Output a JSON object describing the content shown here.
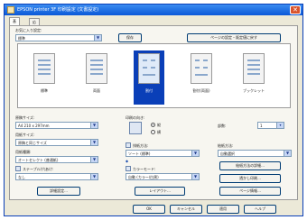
{
  "window": {
    "title": "EPSON printer 3F 印刷設定 (文書設定)",
    "close_glyph": "✕"
  },
  "tabs": [
    {
      "label": "基本設定"
    },
    {
      "label": "応用設定"
    }
  ],
  "top": {
    "favorite_label": "お気に入り設定:",
    "favorite_value": "標準",
    "save_label": "保存",
    "restore_label": "ページの設定・既定値に戻す"
  },
  "layouts": [
    {
      "label": "標準"
    },
    {
      "label": "両面"
    },
    {
      "label": "割付",
      "selected": true
    },
    {
      "label": "割付(両面)"
    },
    {
      "label": "ブックレット"
    }
  ],
  "left": {
    "orig_size_label": "原稿サイズ:",
    "orig_size_value": "A4 210 x 297mm",
    "paper_size_label": "用紙サイズ:",
    "paper_size_value": "原稿と同じサイズ",
    "paper_type_label": "用紙種類:",
    "paper_type_value": "オートセレクト (普通紙)",
    "staple_label": "ステープル/穴あけ:",
    "staple_value": "なし",
    "detail_button": "詳細設定..."
  },
  "middle": {
    "orientation_label": "印刷の向き:",
    "portrait": "縦",
    "landscape": "横",
    "output_label": "排紙方法:",
    "output_value": "ソート (標準)",
    "color_label": "カラーモード:",
    "color_value": "自動 (カラー/白黒)",
    "layout_button": "レイアウト..."
  },
  "right": {
    "copies_label": "部数:",
    "copies_value": "1",
    "source_label": "給紙方法:",
    "source_value": "自動選択",
    "source_button": "給紙方法の詳細...",
    "watermark_button": "透かし印刷...",
    "page_setting_button": "ページ情報..."
  },
  "footer": {
    "ok": "OK",
    "cancel": "キャンセル",
    "apply": "適用",
    "help": "ヘルプ"
  }
}
